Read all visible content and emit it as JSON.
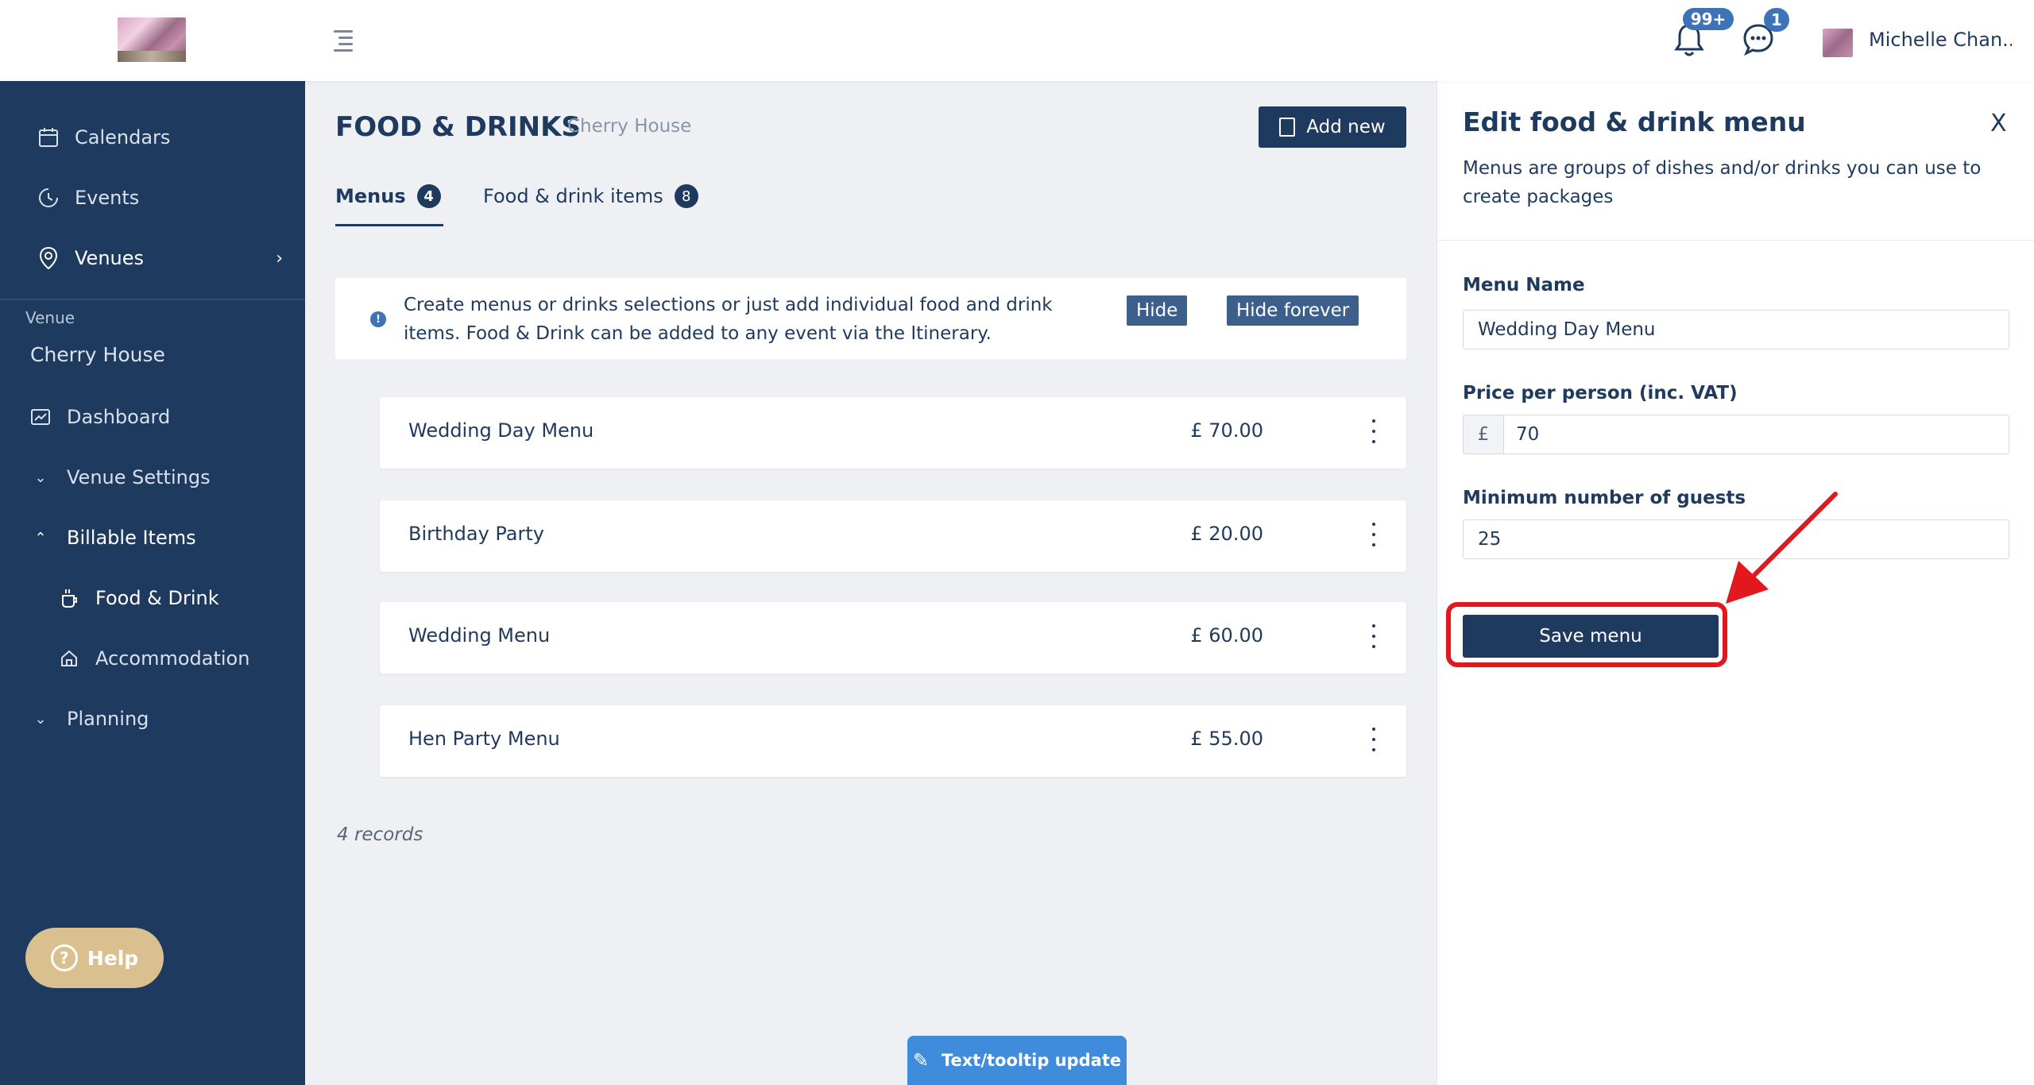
{
  "header": {
    "user_name": "Michelle Chan...",
    "notifications_count": "99+",
    "messages_count": "1"
  },
  "sidebar": {
    "items": [
      {
        "label": "Calendars",
        "icon": "calendar-icon"
      },
      {
        "label": "Events",
        "icon": "clock-icon"
      },
      {
        "label": "Venues",
        "icon": "location-pin-icon"
      }
    ],
    "venue_section_label": "Venue",
    "venue_name": "Cherry House",
    "venue_items": [
      {
        "label": "Dashboard",
        "icon": "dashboard-icon"
      },
      {
        "label": "Venue Settings",
        "icon": "chevron-down-icon"
      },
      {
        "label": "Billable Items",
        "icon": "chevron-up-icon"
      },
      {
        "label": "Food & Drink",
        "icon": "cup-icon"
      },
      {
        "label": "Accommodation",
        "icon": "home-icon"
      },
      {
        "label": "Planning",
        "icon": "chevron-down-icon"
      }
    ],
    "help_label": "Help"
  },
  "main": {
    "title": "FOOD & DRINKS",
    "subtitle": "Cherry House",
    "add_new_label": "Add new",
    "tabs": [
      {
        "label": "Menus",
        "count": "4"
      },
      {
        "label": "Food & drink items",
        "count": "8"
      }
    ],
    "info_text": "Create menus or drinks selections or just add individual food and drink items. Food & Drink can be added to any event via the Itinerary.",
    "hide_label": "Hide",
    "hide_forever_label": "Hide forever",
    "menus": [
      {
        "name": "Wedding Day Menu",
        "price": "£ 70.00"
      },
      {
        "name": "Birthday Party",
        "price": "£ 20.00"
      },
      {
        "name": "Wedding Menu",
        "price": "£ 60.00"
      },
      {
        "name": "Hen Party Menu",
        "price": "£ 55.00"
      }
    ],
    "records_text": "4 records",
    "tooltip_update_label": "Text/tooltip update"
  },
  "panel": {
    "title": "Edit food & drink menu",
    "close_label": "X",
    "description": "Menus are groups of dishes and/or drinks you can use to create packages",
    "menu_name_label": "Menu Name",
    "menu_name_value": "Wedding Day Menu",
    "price_label": "Price per person (inc. VAT)",
    "currency_prefix": "£",
    "price_value": "70",
    "min_guests_label": "Minimum number of guests",
    "min_guests_value": "25",
    "save_label": "Save menu"
  },
  "colors": {
    "sidebar_bg": "#1f3a5f",
    "accent": "#3f73b8",
    "highlight": "#e3181f",
    "help_button": "#d9c08e"
  }
}
